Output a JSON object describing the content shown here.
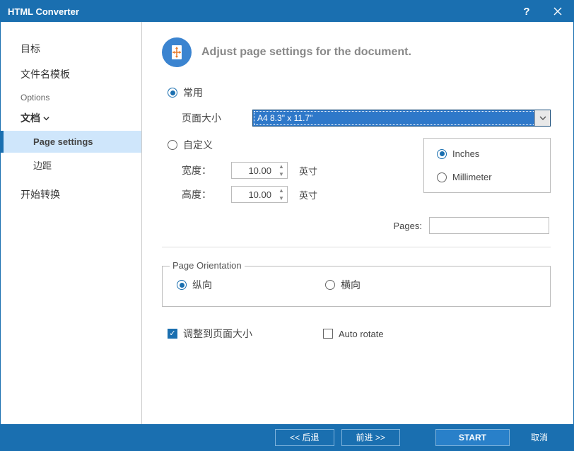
{
  "titlebar": {
    "title": "HTML Converter"
  },
  "sidebar": {
    "item_target": "目标",
    "item_filename": "文件名模板",
    "label_options": "Options",
    "item_doc": "文档",
    "sub_page_settings": "Page settings",
    "sub_margins": "边距",
    "item_start": "开始转换"
  },
  "header": {
    "text": "Adjust page settings for the document."
  },
  "size": {
    "common_label": "常用",
    "page_size_label": "页面大小",
    "page_size_value": "A4 8.3\" x 11.7\"",
    "custom_label": "自定义",
    "width_label": "宽度：",
    "height_label": "高度：",
    "width_value": "10.00",
    "height_value": "10.00",
    "unit_label": "英寸",
    "inches_label": "Inches",
    "mm_label": "Millimeter",
    "pages_label": "Pages:"
  },
  "orientation": {
    "group_title": "Page Orientation",
    "portrait": "纵向",
    "landscape": "横向"
  },
  "options": {
    "fit_to_page": "调整到页面大小",
    "auto_rotate": "Auto rotate"
  },
  "footer": {
    "back": "<< 后退",
    "forward": "前进 >>",
    "start": "START",
    "cancel": "取消"
  }
}
